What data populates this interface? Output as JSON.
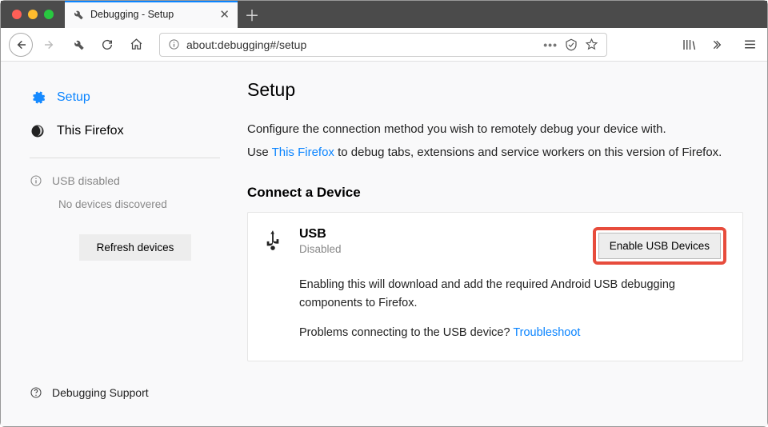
{
  "tab": {
    "title": "Debugging - Setup"
  },
  "url": "about:debugging#/setup",
  "sidebar": {
    "setup": "Setup",
    "this_firefox": "This Firefox",
    "usb_status": "USB disabled",
    "no_devices": "No devices discovered",
    "refresh": "Refresh devices",
    "support": "Debugging Support"
  },
  "main": {
    "title": "Setup",
    "intro_a": "Configure the connection method you wish to remotely debug your device with.",
    "intro_b1": "Use ",
    "intro_link": "This Firefox",
    "intro_b2": " to debug tabs, extensions and service workers on this version of Firefox.",
    "connect_heading": "Connect a Device",
    "usb": {
      "label": "USB",
      "status": "Disabled",
      "enable_button": "Enable USB Devices",
      "desc": "Enabling this will download and add the required Android USB debugging components to Firefox.",
      "trouble_q": "Problems connecting to the USB device? ",
      "trouble_link": "Troubleshoot"
    }
  }
}
